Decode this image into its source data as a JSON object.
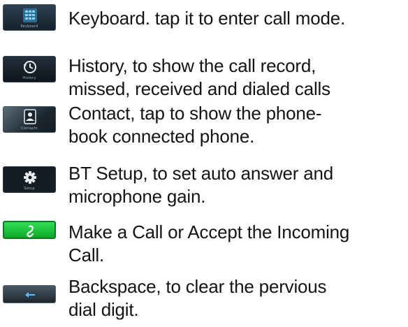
{
  "items": [
    {
      "icon": "keyboard-icon",
      "icon_label": "Keyboard",
      "lines": [
        "Keyboard. tap it to enter call mode."
      ]
    },
    {
      "icon": "history-icon",
      "icon_label": "History",
      "lines": [
        "History, to show the call record,",
        "missed, received and dialed calls"
      ]
    },
    {
      "icon": "contact-icon",
      "icon_label": "Contacts",
      "lines": [
        "Contact, tap to show the phone-",
        "book connected phone."
      ]
    },
    {
      "icon": "gear-icon",
      "icon_label": "Setup",
      "lines": [
        "BT Setup, to set auto answer and",
        "microphone gain."
      ]
    },
    {
      "icon": "phone-call-icon",
      "icon_label": "",
      "lines": [
        "Make a Call or Accept the Incoming",
        "Call."
      ]
    },
    {
      "icon": "backspace-icon",
      "icon_label": "",
      "lines": [
        "Backspace, to clear the pervious",
        "dial digit."
      ]
    }
  ],
  "colors": {
    "icon_bg_dark": "#1c2731",
    "call_green": "#19c43a",
    "text": "#141414"
  }
}
